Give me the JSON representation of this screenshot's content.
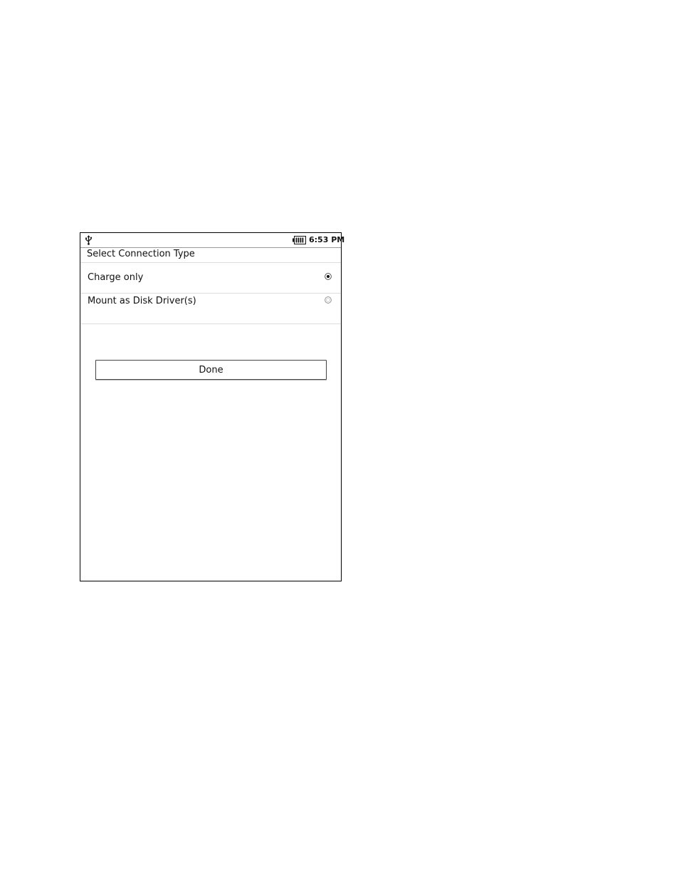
{
  "status_bar": {
    "usb_icon": "usb-icon",
    "battery_icon": "battery-icon",
    "time": "6:53 PM"
  },
  "dialog": {
    "title": "Select Connection Type",
    "options": [
      {
        "label": "Charge only",
        "selected": true
      },
      {
        "label": "Mount as Disk Driver(s)",
        "selected": false
      }
    ],
    "done_label": "Done"
  }
}
